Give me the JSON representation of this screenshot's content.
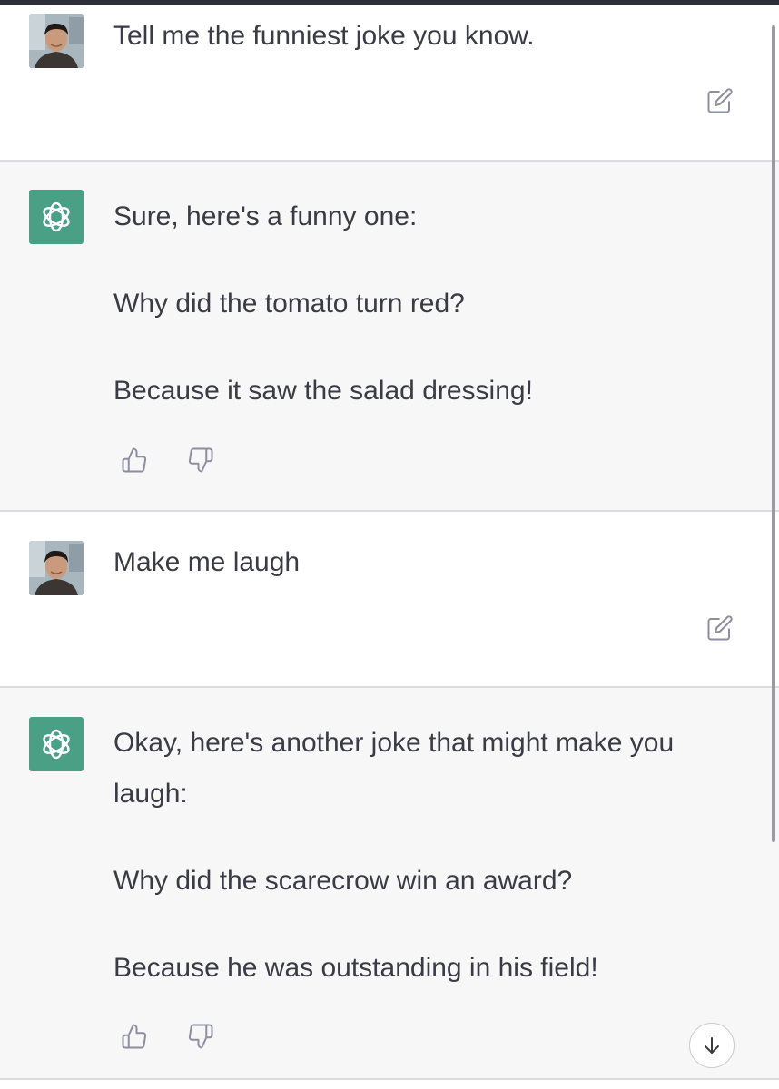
{
  "conversation": {
    "messages": [
      {
        "role": "user",
        "lines": [
          "Tell me the funniest joke you know."
        ]
      },
      {
        "role": "assistant",
        "lines": [
          "Sure, here's a funny one:",
          "Why did the tomato turn red?",
          "Because it saw the salad dressing!"
        ]
      },
      {
        "role": "user",
        "lines": [
          "Make me laugh"
        ]
      },
      {
        "role": "assistant",
        "lines": [
          "Okay, here's another joke that might make you laugh:",
          "Why did the scarecrow win an award?",
          "Because he was outstanding in his field!"
        ]
      }
    ]
  },
  "icons": {
    "edit": "edit-icon",
    "thumbs_up": "thumbs-up-icon",
    "thumbs_down": "thumbs-down-icon",
    "scroll_down": "arrow-down-icon",
    "assistant_logo": "openai-logo-icon",
    "user_avatar": "user-avatar-photo"
  },
  "colors": {
    "assistant_bg": "#f7f7f8",
    "user_bg": "#ffffff",
    "assistant_avatar": "#4aa085",
    "text": "#3a3b45"
  }
}
